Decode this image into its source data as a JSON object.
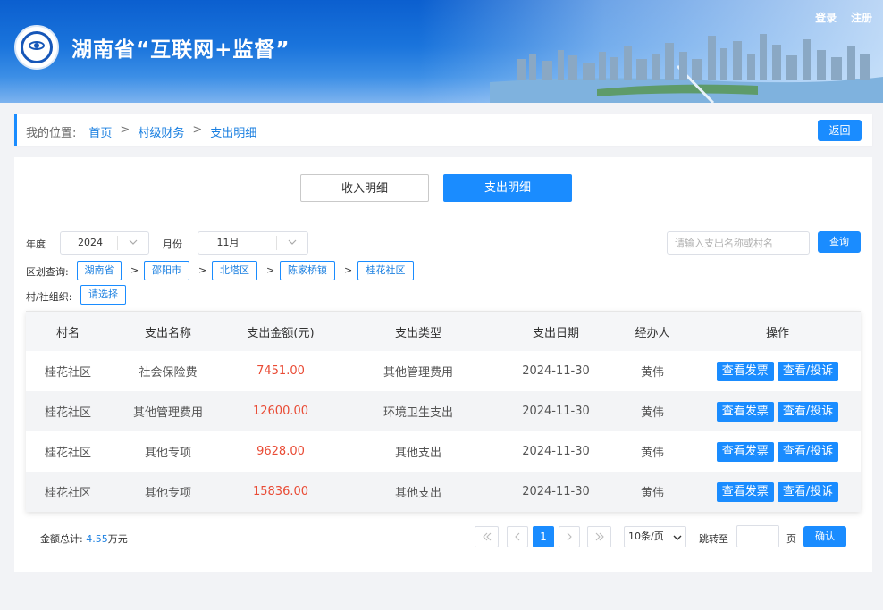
{
  "header": {
    "site_title": "湖南省“互联网+监督”",
    "login": "登录",
    "register": "注册"
  },
  "breadcrumb": {
    "location_label": "我的位置:",
    "items": [
      "首页",
      "村级财务",
      "支出明细"
    ],
    "separator": ">",
    "back_label": "返回"
  },
  "tabs": {
    "income": "收入明细",
    "expense": "支出明细",
    "active": "expense"
  },
  "filters": {
    "year_label": "年度",
    "year_value": "2024",
    "month_label": "月份",
    "month_value": "11月",
    "search_placeholder": "请输入支出名称或村名",
    "search_value": "",
    "query_label": "查询",
    "region_label": "区划查询:",
    "regions": [
      "湖南省",
      "邵阳市",
      "北塔区",
      "陈家桥镇",
      "桂花社区"
    ],
    "region_sep": ">",
    "org_label": "村/社组织:",
    "org_select": "请选择"
  },
  "table": {
    "headers": [
      "村名",
      "支出名称",
      "支出金额(元)",
      "支出类型",
      "支出日期",
      "经办人",
      "操作"
    ],
    "rows": [
      {
        "village": "桂花社区",
        "name": "社会保险费",
        "amount": "7451.00",
        "type": "其他管理费用",
        "date": "2024-11-30",
        "handler": "黄伟"
      },
      {
        "village": "桂花社区",
        "name": "其他管理费用",
        "amount": "12600.00",
        "type": "环境卫生支出",
        "date": "2024-11-30",
        "handler": "黄伟"
      },
      {
        "village": "桂花社区",
        "name": "其他专项",
        "amount": "9628.00",
        "type": "其他支出",
        "date": "2024-11-30",
        "handler": "黄伟"
      },
      {
        "village": "桂花社区",
        "name": "其他专项",
        "amount": "15836.00",
        "type": "其他支出",
        "date": "2024-11-30",
        "handler": "黄伟"
      }
    ],
    "action_invoice": "查看发票",
    "action_complain": "查看/投诉"
  },
  "footer": {
    "total_label": "金额总计:",
    "total_value": "4.55",
    "total_unit": "万元",
    "current_page": "1",
    "page_size": "10条/页",
    "jump_label": "跳转至",
    "jump_value": "",
    "page_label": "页",
    "confirm_label": "确认"
  },
  "colors": {
    "primary": "#1a8cff",
    "amount": "#e94b35",
    "header_blue": "#0b5fcf"
  }
}
